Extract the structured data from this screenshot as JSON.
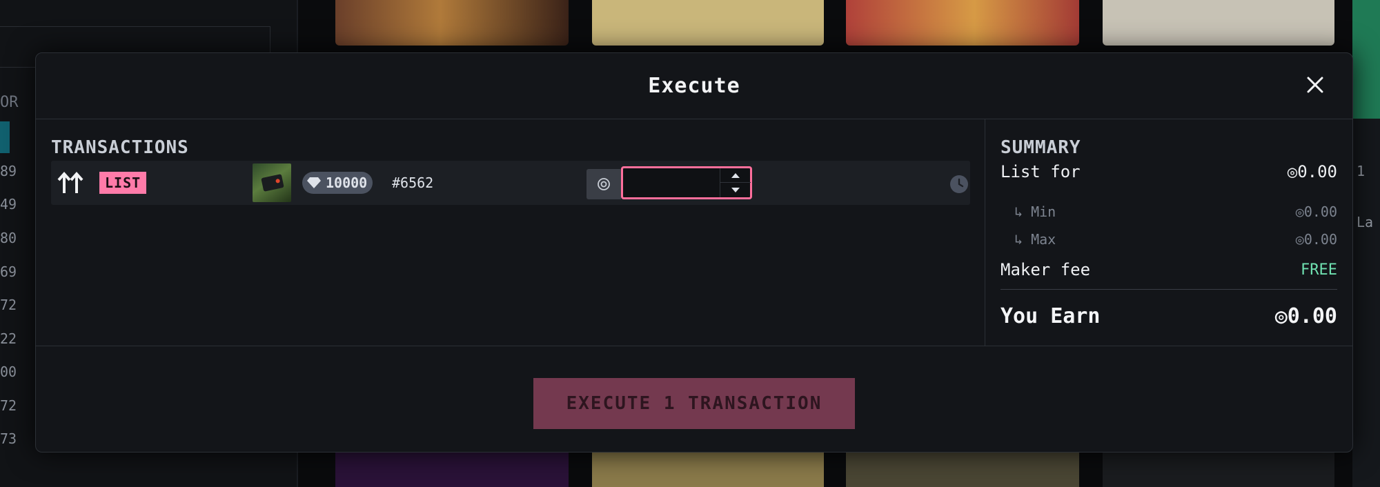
{
  "modal": {
    "title": "Execute",
    "close_icon": "close-icon"
  },
  "transactions": {
    "heading": "TRANSACTIONS",
    "rows": [
      {
        "action": "LIST",
        "rarity": "10000",
        "token_id": "#6562",
        "currency_symbol": "◎",
        "price_value": ""
      }
    ]
  },
  "summary": {
    "heading": "SUMMARY",
    "list_for_label": "List for",
    "list_for_value": "◎0.00",
    "min_label": "↳ Min",
    "min_value": "◎0.00",
    "max_label": "↳ Max",
    "max_value": "◎0.00",
    "maker_fee_label": "Maker fee",
    "maker_fee_value": "FREE",
    "you_earn_label": "You Earn",
    "you_earn_value": "◎0.00"
  },
  "footer": {
    "execute_label": "EXECUTE 1 TRANSACTION"
  },
  "background": {
    "left_header": "OR",
    "left_numbers": [
      "89",
      "49",
      "80",
      "69",
      "72",
      "22",
      "00",
      "72",
      "73"
    ],
    "right_fragments": [
      "1",
      "La"
    ]
  },
  "colors": {
    "accent_pink": "#ff7ba9",
    "execute_disabled": "#7a3b52",
    "free_green": "#6fe0b0"
  }
}
